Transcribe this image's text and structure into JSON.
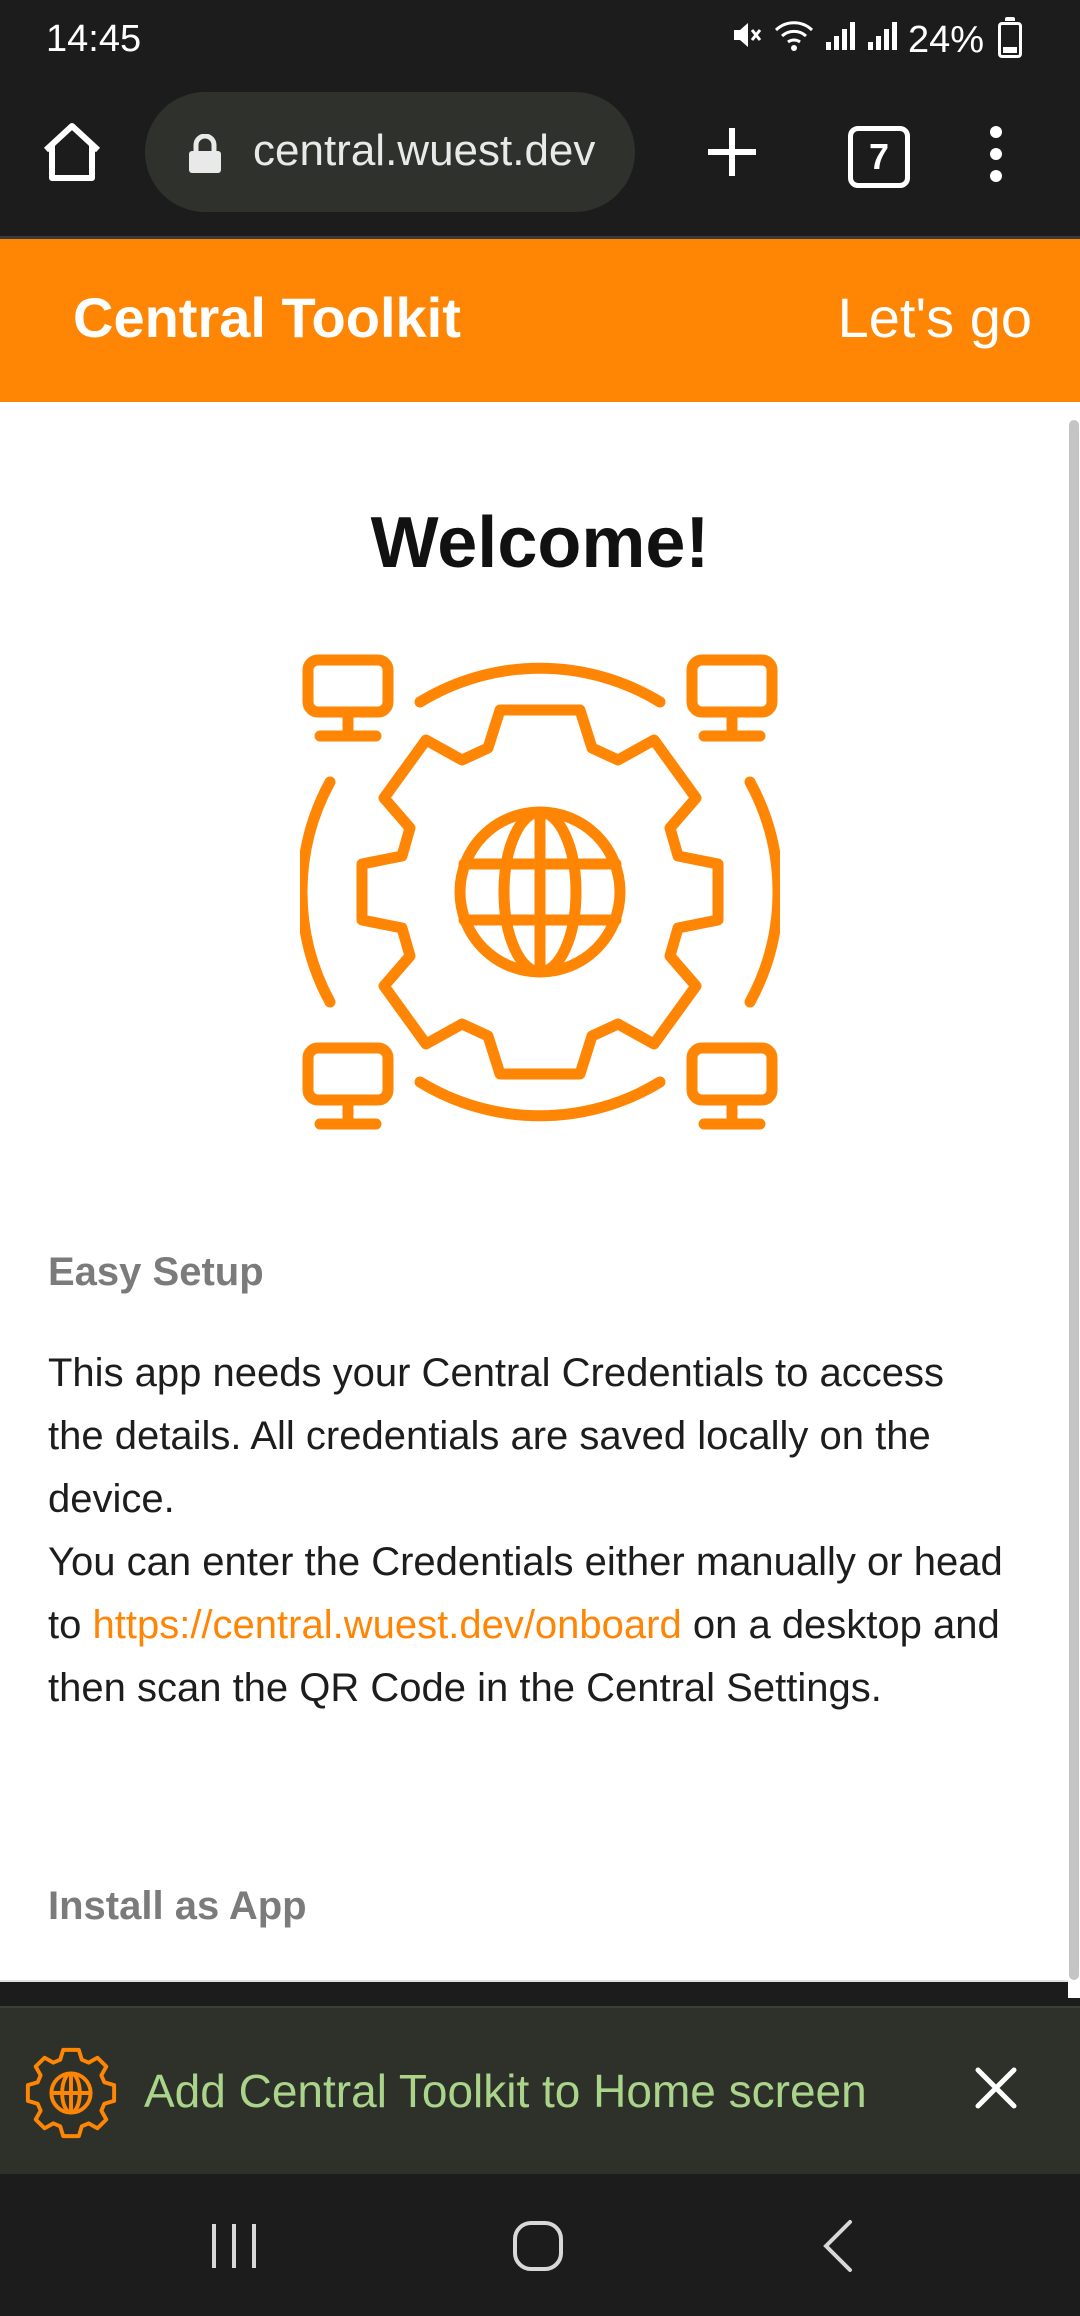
{
  "status_bar": {
    "time": "14:45",
    "battery": "24%",
    "icons": [
      "mute-icon",
      "wifi-icon",
      "signal-icon",
      "signal-icon",
      "battery-icon"
    ]
  },
  "browser": {
    "url": "central.wuest.dev",
    "tab_count": "7",
    "icons": [
      "home-icon",
      "lock-icon",
      "plus-icon",
      "tabs-icon",
      "more-vert-icon"
    ]
  },
  "app_header": {
    "title": "Central Toolkit",
    "action": "Let's go"
  },
  "main": {
    "heading": "Welcome!",
    "hero_icon": "gear-globe-network-icon",
    "sections": [
      {
        "heading": "Easy Setup",
        "paragraph1": "This app needs your Central Credentials to access the details. All credentials are saved locally on the device.",
        "paragraph2_before": "You can enter the Credentials either manually or head to ",
        "paragraph2_link": "https://central.wuest.dev/onboard",
        "paragraph2_after": " on a desktop and then scan the QR Code in the Central Settings."
      },
      {
        "heading": "Install as App"
      }
    ]
  },
  "install_banner": {
    "text": "Add Central Toolkit to Home screen",
    "icon": "gear-globe-icon",
    "close_icon": "close-icon"
  },
  "nav_bar": {
    "icons": [
      "recents-icon",
      "home-circle-icon",
      "back-icon"
    ]
  },
  "colors": {
    "accent": "#ff8605",
    "banner_text": "#a9d48a",
    "system_bg": "#1c1c1c",
    "banner_bg": "#2e312a"
  }
}
